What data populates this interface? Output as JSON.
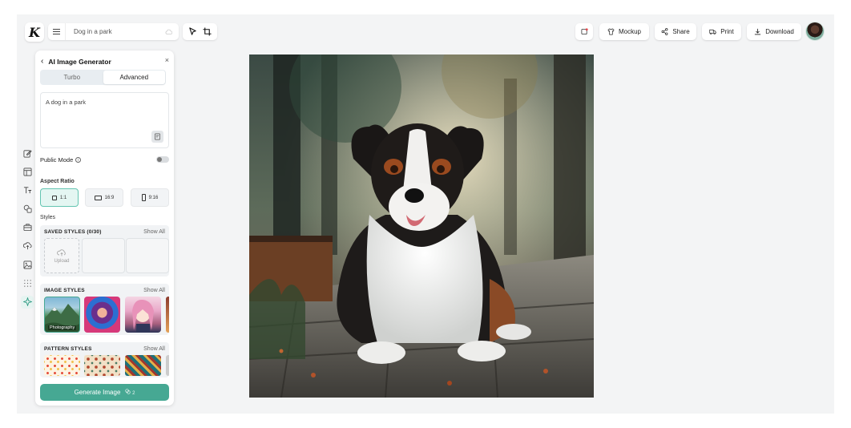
{
  "app": {
    "logo_letter": "K",
    "search_value": "Dog in a park"
  },
  "toolbar": {
    "mockup_label": "Mockup",
    "share_label": "Share",
    "print_label": "Print",
    "download_label": "Download"
  },
  "panel": {
    "title": "AI Image Generator",
    "close_glyph": "×",
    "back_glyph": "‹",
    "tabs": [
      {
        "label": "Turbo",
        "active": false
      },
      {
        "label": "Advanced",
        "active": true
      }
    ],
    "prompt_value": "A dog in a park",
    "public_mode_label": "Public Mode",
    "public_mode_on": false,
    "aspect_ratio_label": "Aspect Ratio",
    "aspect_ratios": [
      {
        "label": "1:1",
        "active": true
      },
      {
        "label": "16:9",
        "active": false
      },
      {
        "label": "9:16",
        "active": false
      }
    ],
    "styles_label": "Styles",
    "saved_styles": {
      "title": "SAVED STYLES (0/30)",
      "show_all": "Show All",
      "upload_label": "Upload"
    },
    "image_styles": {
      "title": "IMAGE STYLES",
      "show_all": "Show All",
      "first_label": "Photography"
    },
    "pattern_styles": {
      "title": "PATTERN STYLES",
      "show_all": "Show All"
    },
    "generate_label": "Generate Image",
    "generate_cost": "2"
  },
  "colors": {
    "accent": "#46a893",
    "accent_light": "#e4f6f2",
    "workspace_bg": "#f3f4f5"
  }
}
